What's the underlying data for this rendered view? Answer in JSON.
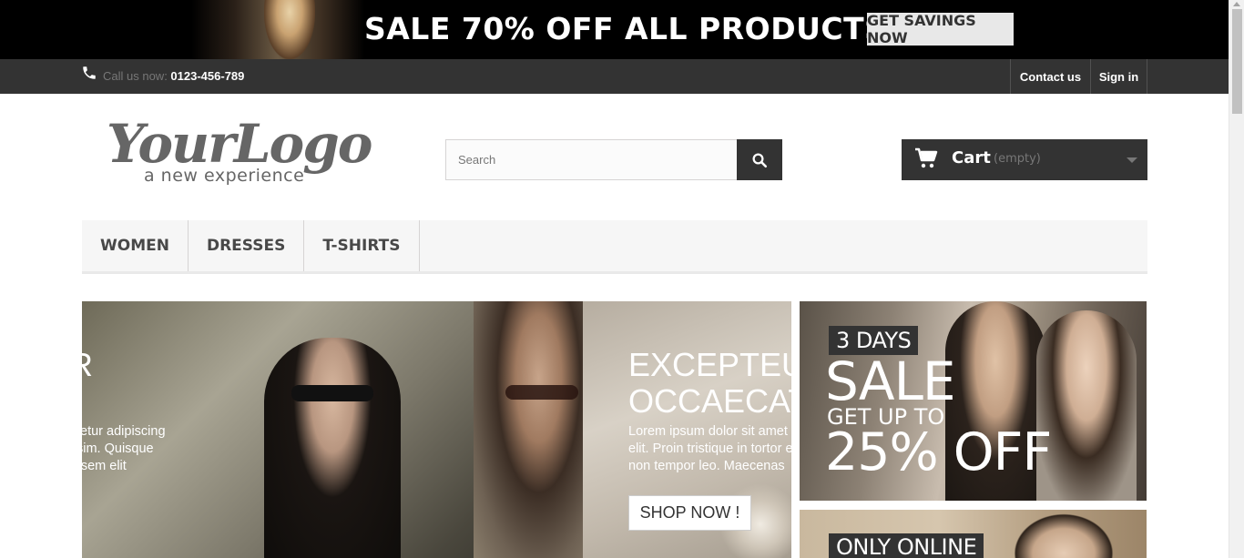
{
  "promo": {
    "text": "SALE 70% OFF ALL PRODUCTS",
    "button_label": "GET SAVINGS NOW"
  },
  "topbar": {
    "call_label": "Call us now: ",
    "phone_number": "0123-456-789",
    "contact_label": "Contact us",
    "signin_label": "Sign in"
  },
  "logo": {
    "script_text": "YourLogo",
    "tagline": "a new experience"
  },
  "search": {
    "placeholder": "Search"
  },
  "cart": {
    "label": "Cart",
    "status": "(empty)"
  },
  "menu": {
    "items": [
      {
        "label": "Women"
      },
      {
        "label": "Dresses"
      },
      {
        "label": "T-shirts"
      }
    ]
  },
  "slider": {
    "slide_a": {
      "title": "UR\nT",
      "body": ", consectetur adipiscing\net dignissim. Quisque\n egestas sem elit"
    },
    "slide_b": {
      "title": "EXCEPTEU\nOCCAECAT",
      "body": "Lorem ipsum dolor sit amet\nelit. Proin tristique in tortor e\nnon tempor leo. Maecenas",
      "button_label": "SHOP NOW !"
    }
  },
  "banners": {
    "banner1": {
      "days": "3 DAYS",
      "sale": "SALE",
      "upto": "GET UP TO",
      "off": "25% OFF"
    },
    "banner2": {
      "label": "ONLY ONLINE"
    }
  },
  "colors": {
    "dark": "#333333",
    "menu_bg": "#f6f6f6",
    "promo_bg": "#000000"
  }
}
